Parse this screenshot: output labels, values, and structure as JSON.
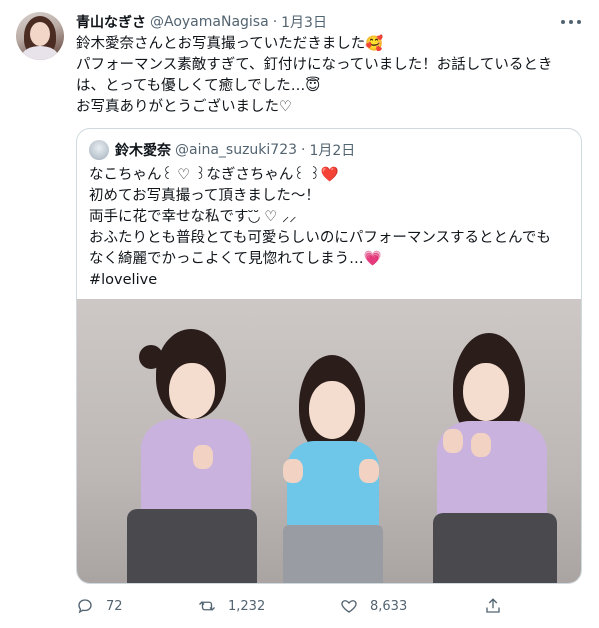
{
  "tweet": {
    "display_name": "青山なぎさ",
    "handle": "@AoyamaNagisa",
    "separator": "·",
    "date": "1月3日",
    "lines": [
      "鈴木愛奈さんとお写真撮っていただきました🥰",
      "パフォーマンス素敵すぎて、釘付けになっていました！お話しているとき",
      "は、とっても優しくて癒しでした…😇",
      "お写真ありがとうございました♡"
    ]
  },
  "quoted": {
    "display_name": "鈴木愛奈",
    "handle": "@aina_suzuki723",
    "separator": "·",
    "date": "1月2日",
    "lines": [
      "なこちゃん꒰ ♡ ꒱なぎさちゃん꒰ ꒱❤️",
      "初めてお写真撮って頂きました〜！",
      "両手に花で幸せな私です◟̆◞̆ ♡ ⸝⸝",
      "おふたりとも普段とても可愛らしいのにパフォーマンスするととんでも",
      "なく綺麗でかっこよくて見惚れてしまう…💗",
      "#lovelive"
    ]
  },
  "actions": {
    "reply_count": "72",
    "retweet_count": "1,232",
    "like_count": "8,633"
  },
  "icons": {
    "reply": "reply-icon",
    "retweet": "retweet-icon",
    "like": "like-icon",
    "share": "share-icon",
    "more": "more-icon"
  },
  "colors": {
    "text": "#0f1419",
    "secondary": "#536471",
    "border": "#cfd9de",
    "shirt_purple": "#c9b2de",
    "shirt_blue": "#6ec6e8"
  }
}
